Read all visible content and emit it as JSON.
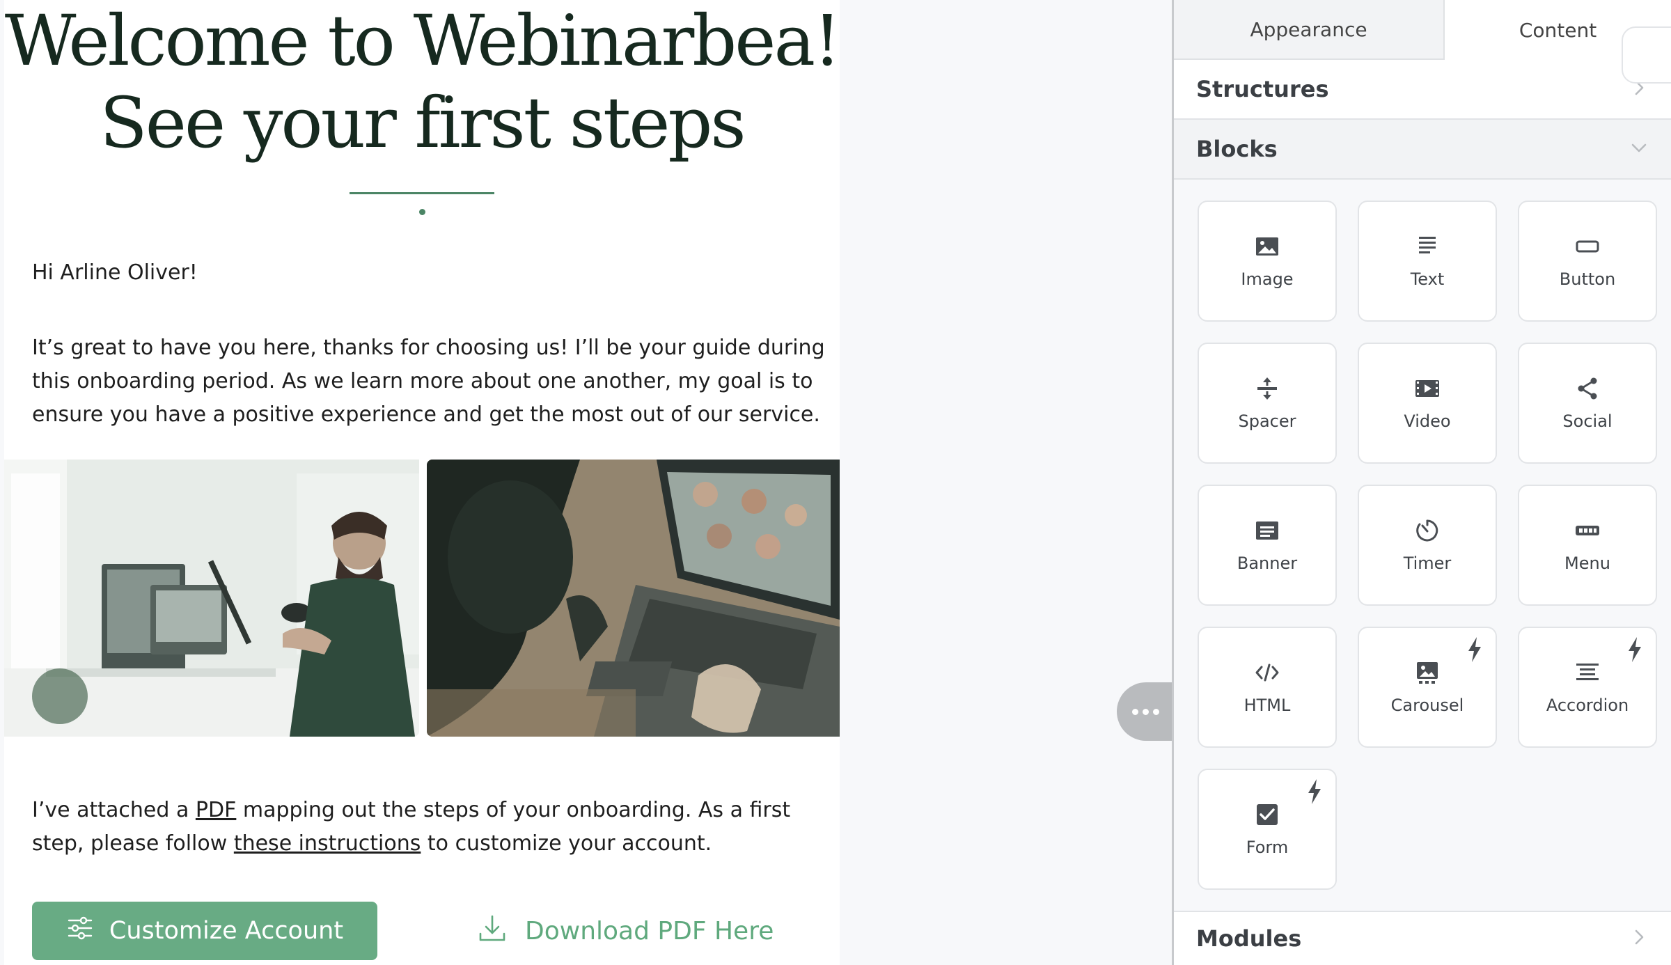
{
  "email": {
    "heading_line1": "Welcome to Webinarbea!",
    "heading_line2": "See your first steps",
    "greeting": "Hi Arline Oliver!",
    "paragraph": "It’s great to have you here, thanks for choosing us! I’ll be your guide during this onboarding period. As we learn more about one another, my goal is to ensure you have a positive experience and get the most out of our service.",
    "paragraph2": {
      "part1": "I’ve attached a ",
      "link1": "PDF",
      "part2": " mapping out the steps of your onboarding. As a first step, please follow ",
      "link2": "these instructions",
      "part3": " to customize your account."
    },
    "customize_button": "Customize Account",
    "download_button": "Download PDF Here"
  },
  "panel": {
    "tabs": [
      "Appearance",
      "Content"
    ],
    "active_tab": "Content",
    "sections": {
      "structures": "Structures",
      "blocks": "Blocks",
      "modules": "Modules"
    },
    "blocks": [
      {
        "label": "Image",
        "icon": "image-icon"
      },
      {
        "label": "Text",
        "icon": "text-icon"
      },
      {
        "label": "Button",
        "icon": "button-icon"
      },
      {
        "label": "Spacer",
        "icon": "spacer-icon"
      },
      {
        "label": "Video",
        "icon": "video-icon"
      },
      {
        "label": "Social",
        "icon": "share-icon"
      },
      {
        "label": "Banner",
        "icon": "banner-icon"
      },
      {
        "label": "Timer",
        "icon": "timer-icon"
      },
      {
        "label": "Menu",
        "icon": "menu-icon"
      },
      {
        "label": "HTML",
        "icon": "code-icon"
      },
      {
        "label": "Carousel",
        "icon": "carousel-icon",
        "bolt": true
      },
      {
        "label": "Accordion",
        "icon": "accordion-icon",
        "bolt": true
      },
      {
        "label": "Form",
        "icon": "checkbox-icon",
        "bolt": true
      }
    ]
  },
  "colors": {
    "accent_green": "#68ab84",
    "heading_dark": "#16291f",
    "link_green": "#5fa97d"
  }
}
